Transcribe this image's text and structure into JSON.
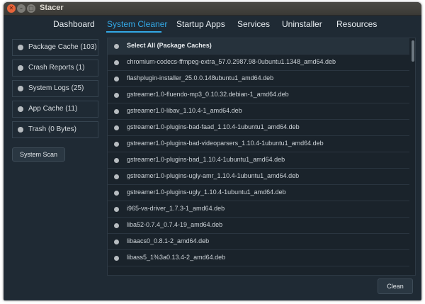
{
  "window": {
    "title": "Stacer",
    "buttons": [
      "close-icon",
      "minimize-icon",
      "maximize-icon"
    ]
  },
  "tabs": [
    {
      "label": "Dashboard",
      "active": false
    },
    {
      "label": "System Cleaner",
      "active": true
    },
    {
      "label": "Startup Apps",
      "active": false
    },
    {
      "label": "Services",
      "active": false
    },
    {
      "label": "Uninstaller",
      "active": false
    },
    {
      "label": "Resources",
      "active": false
    }
  ],
  "sidebar": {
    "items": [
      {
        "label": "Package Cache (103)"
      },
      {
        "label": "Crash Reports (1)"
      },
      {
        "label": "System Logs (25)"
      },
      {
        "label": "App Cache (11)"
      },
      {
        "label": "Trash (0 Bytes)"
      }
    ],
    "scan_label": "System Scan"
  },
  "list": {
    "header": "Select All (Package Caches)",
    "items": [
      "chromium-codecs-ffmpeg-extra_57.0.2987.98-0ubuntu1.1348_amd64.deb",
      "flashplugin-installer_25.0.0.148ubuntu1_amd64.deb",
      "gstreamer1.0-fluendo-mp3_0.10.32.debian-1_amd64.deb",
      "gstreamer1.0-libav_1.10.4-1_amd64.deb",
      "gstreamer1.0-plugins-bad-faad_1.10.4-1ubuntu1_amd64.deb",
      "gstreamer1.0-plugins-bad-videoparsers_1.10.4-1ubuntu1_amd64.deb",
      "gstreamer1.0-plugins-bad_1.10.4-1ubuntu1_amd64.deb",
      "gstreamer1.0-plugins-ugly-amr_1.10.4-1ubuntu1_amd64.deb",
      "gstreamer1.0-plugins-ugly_1.10.4-1ubuntu1_amd64.deb",
      "i965-va-driver_1.7.3-1_amd64.deb",
      "liba52-0.7.4_0.7.4-19_amd64.deb",
      "libaacs0_0.8.1-2_amd64.deb",
      "libass5_1%3a0.13.4-2_amd64.deb"
    ]
  },
  "footer": {
    "clean_label": "Clean"
  },
  "colors": {
    "background": "#1f2a34",
    "accent": "#33a8e6",
    "text": "#e9eef2"
  }
}
